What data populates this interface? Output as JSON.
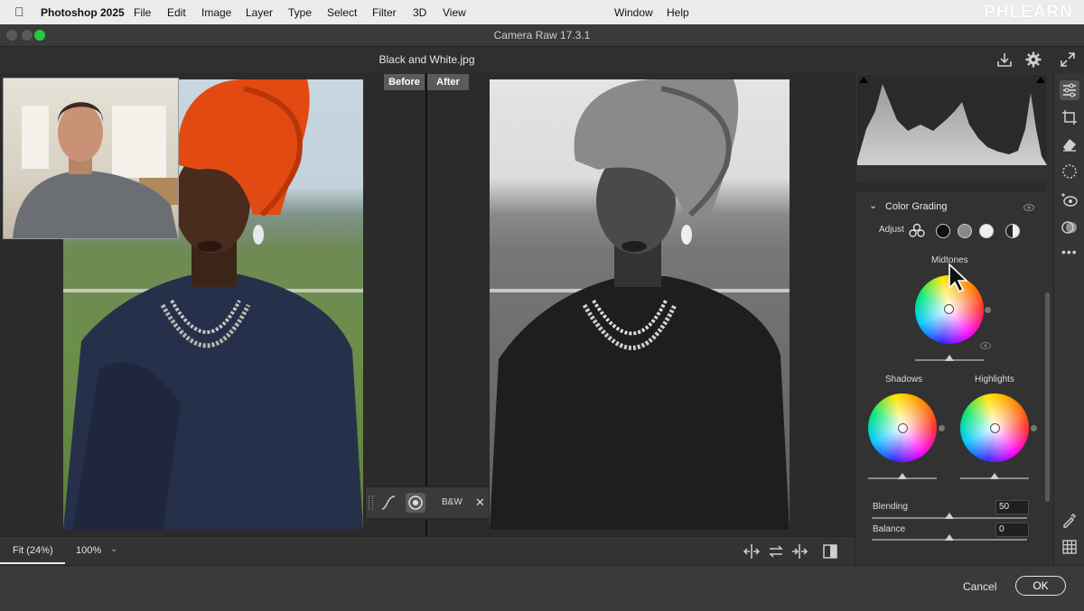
{
  "menubar": {
    "app_name": "Photoshop 2025",
    "items": [
      "File",
      "Edit",
      "Image",
      "Layer",
      "Type",
      "Select",
      "Filter",
      "3D",
      "View",
      "Window",
      "Help"
    ],
    "watermark": "PHLEARN"
  },
  "window": {
    "title": "Camera Raw 17.3.1",
    "filename": "Black and White.jpg"
  },
  "view": {
    "before_label": "Before",
    "after_label": "After"
  },
  "mini_toolbar": {
    "bw_label": "B&W"
  },
  "bottom": {
    "fit_label": "Fit (24%)",
    "zoom_label": "100%"
  },
  "panel": {
    "section_title": "Color Grading",
    "adjust_label": "Adjust",
    "midtones_label": "Midtones",
    "shadows_label": "Shadows",
    "highlights_label": "Highlights",
    "blending_label": "Blending",
    "blending_value": "50",
    "balance_label": "Balance",
    "balance_value": "0"
  },
  "footer": {
    "cancel_label": "Cancel",
    "ok_label": "OK"
  },
  "colors": {
    "accent": "#e8e8e8",
    "background": "#2b2b2b",
    "panel": "#323232"
  },
  "icons": [
    "apple-icon",
    "save-icon",
    "gear-icon",
    "fullscreen-icon",
    "edit-sliders-icon",
    "crop-icon",
    "eraser-icon",
    "masking-icon",
    "redeye-icon",
    "presets-icon",
    "more-icon",
    "eyedropper-icon",
    "grid-icon"
  ]
}
